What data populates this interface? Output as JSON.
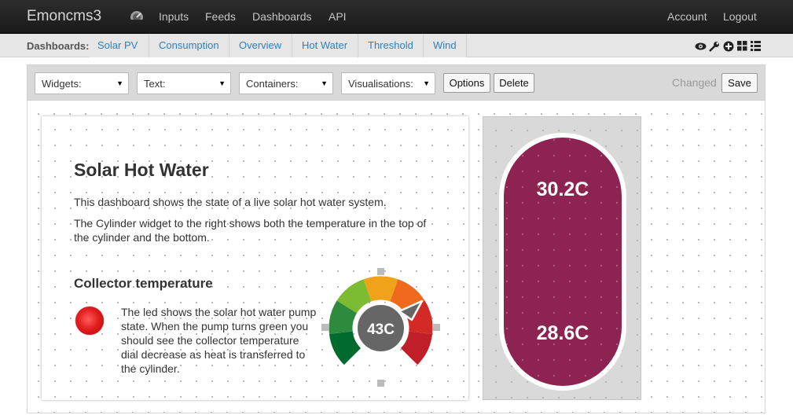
{
  "app": {
    "brand": "Emoncms3",
    "nav": [
      "Inputs",
      "Feeds",
      "Dashboards",
      "API"
    ],
    "account": "Account",
    "logout": "Logout"
  },
  "dashboards": {
    "label": "Dashboards:",
    "tabs": [
      "Solar PV",
      "Consumption",
      "Overview",
      "Hot Water",
      "Threshold",
      "Wind"
    ],
    "tool_icons": [
      "eye-icon",
      "wrench-icon",
      "plus-circle-icon",
      "grid-icon",
      "list-icon"
    ]
  },
  "toolbar": {
    "widgets": "Widgets:",
    "text": "Text:",
    "containers": "Containers:",
    "visualisations": "Visualisations:",
    "options": "Options",
    "delete": "Delete",
    "status": "Changed",
    "save": "Save"
  },
  "content": {
    "title": "Solar Hot Water",
    "para1": "This dashboard shows the state of a live solar hot water system.",
    "para2_line1": "The Cylinder widget to the right shows both the temperature in the top of",
    "para2_line2": "the cylinder and the bottom.",
    "collector_title": "Collector temperature",
    "led_text": "The led shows the solar hot water pump state. When the pump turns green you should see the collector temperature dial decrease as heat is transferred to the cylinder.",
    "dial_value": "43C",
    "led_state": "red"
  },
  "cylinder": {
    "top_temp": "30.2C",
    "bottom_temp": "28.6C",
    "color": "#8c2350"
  },
  "colors": {
    "link": "#2f7fbf",
    "dial_segments": [
      "#006b2d",
      "#2e8b3e",
      "#7dbb33",
      "#f0a21b",
      "#f06a1e",
      "#d42a26",
      "#c01f2a"
    ]
  }
}
